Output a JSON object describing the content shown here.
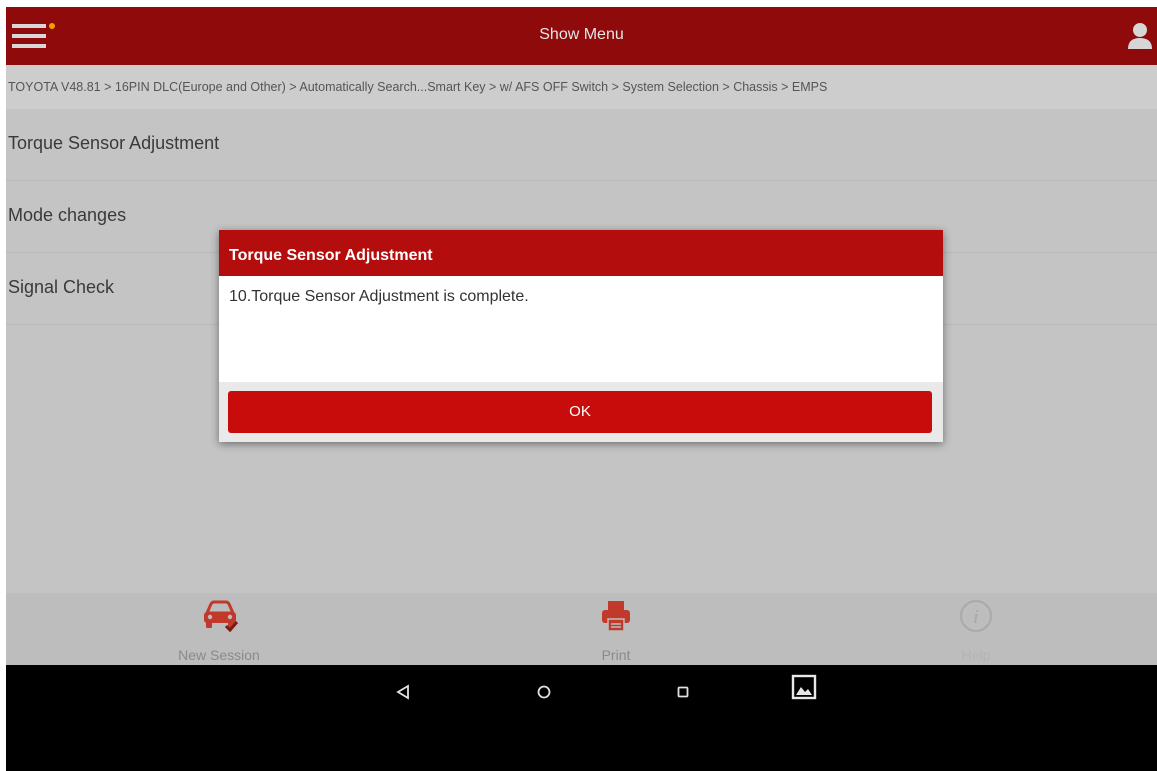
{
  "app": {
    "title": "Show Menu",
    "accent_color": "#8e0a0b",
    "notification_dot_color": "#f2a200"
  },
  "header": {
    "menu_icon": "hamburger-menu-icon",
    "user_icon": "user-icon"
  },
  "breadcrumb": {
    "text": "TOYOTA V48.81 > 16PIN DLC(Europe and Other) > Automatically Search...Smart Key > w/ AFS OFF Switch > System Selection > Chassis > EMPS"
  },
  "menu_list": {
    "items": [
      {
        "label": "Torque Sensor Adjustment"
      },
      {
        "label": "Mode changes"
      },
      {
        "label": "Signal Check"
      }
    ]
  },
  "dialog": {
    "title": "Torque Sensor Adjustment",
    "message": "10.Torque Sensor Adjustment is complete.",
    "ok_label": "OK",
    "header_color": "#b30d0d",
    "button_color": "#c80c0c"
  },
  "bottom_toolbar": {
    "items": [
      {
        "label": "New Session",
        "icon": "car-check-icon",
        "enabled": true
      },
      {
        "label": "Print",
        "icon": "printer-icon",
        "enabled": true
      },
      {
        "label": "Help",
        "icon": "info-icon",
        "enabled": false
      }
    ]
  },
  "system_nav": {
    "buttons": [
      "back-icon",
      "home-icon",
      "recents-icon",
      "screenshot-icon"
    ]
  }
}
